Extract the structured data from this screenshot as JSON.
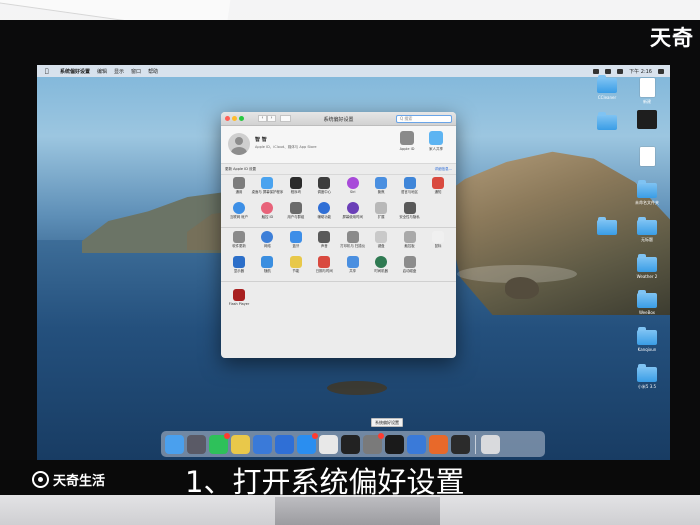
{
  "overlay": {
    "brand_top": "天奇",
    "brand_bottom": "天奇生活",
    "subtitle": "1、打开系统偏好设置"
  },
  "menubar": {
    "app": "系统偏好设置",
    "items": [
      "编辑",
      "显示",
      "窗口",
      "帮助"
    ],
    "clock": "下午 2:16"
  },
  "window": {
    "title": "系统偏好设置",
    "search_placeholder": "Q 搜索",
    "account_name": "智 智",
    "account_sub": "Apple ID、iCloud、媒体与 App Store",
    "account_icons": [
      {
        "label": "Apple ID",
        "icon": "apple-id-icon",
        "color": "#8a8a8a"
      },
      {
        "label": "家人共享",
        "icon": "family-sharing-icon",
        "color": "#5db4f2"
      }
    ],
    "notice": "更新 Apple ID 设置",
    "notice_link": "详细信息...",
    "rows": [
      [
        {
          "label": "通用",
          "icon": "general-icon",
          "color": "#7c7c7c"
        },
        {
          "label": "桌面与\n屏幕保护程序",
          "icon": "desktop-icon",
          "color": "#4aa3ef"
        },
        {
          "label": "程序坞",
          "icon": "dock-icon",
          "color": "#2b2b2b"
        },
        {
          "label": "调度中心",
          "icon": "mission-control-icon",
          "color": "#3d3d3d"
        },
        {
          "label": "Siri",
          "icon": "siri-icon",
          "color": "#a84ad9"
        },
        {
          "label": "聚焦",
          "icon": "spotlight-icon",
          "color": "#4a8fe0"
        },
        {
          "label": "语言与地区",
          "icon": "language-icon",
          "color": "#3f86d9"
        },
        {
          "label": "通知",
          "icon": "notifications-icon",
          "color": "#d94a3f"
        }
      ],
      [
        {
          "label": "互联网\n帐户",
          "icon": "internet-accounts-icon",
          "color": "#3d8fe6"
        },
        {
          "label": "触控 ID",
          "icon": "touch-id-icon",
          "color": "#e8637a"
        },
        {
          "label": "用户与群组",
          "icon": "users-icon",
          "color": "#6b6b6b"
        },
        {
          "label": "辅助功能",
          "icon": "accessibility-icon",
          "color": "#2f6fd6"
        },
        {
          "label": "屏幕使用时间",
          "icon": "screen-time-icon",
          "color": "#6b3fb8"
        },
        {
          "label": "扩展",
          "icon": "extensions-icon",
          "color": "#b8b8b8"
        },
        {
          "label": "安全性与隐私",
          "icon": "security-icon",
          "color": "#595959"
        }
      ],
      [
        {
          "label": "软件更新",
          "icon": "software-update-icon",
          "color": "#8a8a8a"
        },
        {
          "label": "网络",
          "icon": "network-icon",
          "color": "#3d7fd8"
        },
        {
          "label": "蓝牙",
          "icon": "bluetooth-icon",
          "color": "#3d8ee8"
        },
        {
          "label": "声音",
          "icon": "sound-icon",
          "color": "#5a5a5a"
        },
        {
          "label": "打印机与\n扫描仪",
          "icon": "printer-icon",
          "color": "#8a8a8a"
        },
        {
          "label": "键盘",
          "icon": "keyboard-icon",
          "color": "#c9c9c9"
        },
        {
          "label": "触控板",
          "icon": "trackpad-icon",
          "color": "#a9a9a9"
        },
        {
          "label": "鼠标",
          "icon": "mouse-icon",
          "color": "#f0f0f0"
        }
      ],
      [
        {
          "label": "显示器",
          "icon": "displays-icon",
          "color": "#2c6fc9"
        },
        {
          "label": "随航",
          "icon": "sidecar-icon",
          "color": "#3a8ee0"
        },
        {
          "label": "节能",
          "icon": "energy-saver-icon",
          "color": "#e8c84a"
        },
        {
          "label": "日期与时间",
          "icon": "date-time-icon",
          "color": "#d94a3f"
        },
        {
          "label": "共享",
          "icon": "sharing-icon",
          "color": "#4a8fe0"
        },
        {
          "label": "时间机器",
          "icon": "time-machine-icon",
          "color": "#2f7a52"
        },
        {
          "label": "启动磁盘",
          "icon": "startup-disk-icon",
          "color": "#8c8c8c"
        }
      ]
    ],
    "third_party": [
      {
        "label": "Flash Player",
        "icon": "flash-player-icon",
        "color": "#a82020"
      }
    ]
  },
  "desktop_icons": [
    {
      "label": "CCleaner",
      "icon": "folder-icon"
    },
    {
      "label": "新建",
      "icon": "file-icon"
    },
    {
      "label": "",
      "icon": "folder-icon"
    },
    {
      "label": "",
      "icon": "dark-file-icon"
    },
    {
      "label": "",
      "icon": "file-icon"
    },
    {
      "label": "未命名文件夹",
      "icon": "folder-icon"
    },
    {
      "label": "无标题",
      "icon": "folder-icon"
    },
    {
      "label": "",
      "icon": "folder-icon"
    },
    {
      "label": "Weather 2",
      "icon": "folder-icon"
    },
    {
      "label": "WeeBox",
      "icon": "folder-icon"
    },
    {
      "label": "Kanqixun",
      "icon": "folder-icon"
    },
    {
      "label": "小米5 3.5",
      "icon": "folder-icon"
    }
  ],
  "dock": {
    "tooltip": "系统偏好设置",
    "items": [
      {
        "icon": "finder-icon",
        "color": "#4aa0ee"
      },
      {
        "icon": "launchpad-icon",
        "color": "#5a5a66"
      },
      {
        "icon": "wechat-icon",
        "color": "#2ec15a",
        "badge": true
      },
      {
        "icon": "notes-icon",
        "color": "#e9c84a"
      },
      {
        "icon": "xcode-icon",
        "color": "#3a7ad9"
      },
      {
        "icon": "app-icon",
        "color": "#2f6fd6"
      },
      {
        "icon": "app-store-icon",
        "color": "#2a8ef0",
        "badge": true
      },
      {
        "icon": "download-icon",
        "color": "#e8e8e8"
      },
      {
        "icon": "terminal-icon",
        "color": "#222222"
      },
      {
        "icon": "system-preferences-icon",
        "color": "#7a7a7a",
        "badge": true
      },
      {
        "icon": "qq-icon",
        "color": "#1a1a1a"
      },
      {
        "icon": "wps-icon",
        "color": "#3a7ad9"
      },
      {
        "icon": "firefox-icon",
        "color": "#e8692a"
      },
      {
        "icon": "activity-monitor-icon",
        "color": "#2b2b2b"
      },
      {
        "icon": "trash-icon",
        "color": "#d9dadd"
      }
    ]
  }
}
